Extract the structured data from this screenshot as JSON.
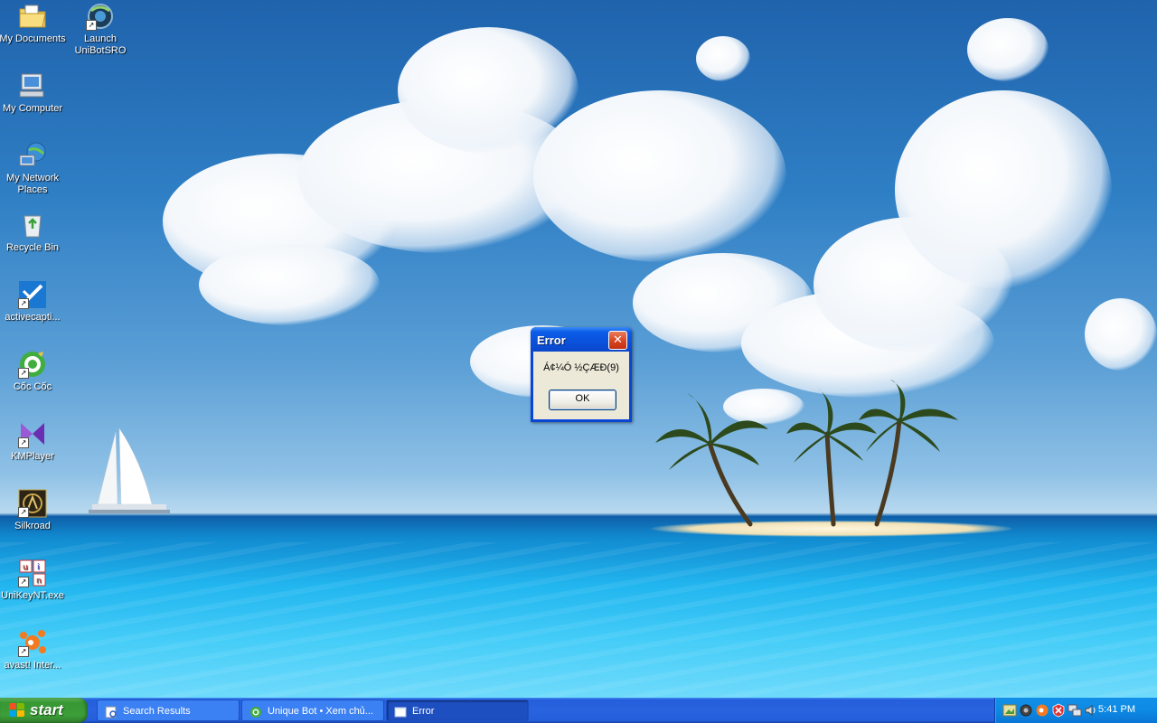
{
  "desktop": {
    "icons": [
      {
        "label": "My Documents",
        "icon": "folder-documents-icon"
      },
      {
        "label": "Launch UniBotSRO",
        "icon": "unibot-icon"
      },
      {
        "label": "My Computer",
        "icon": "computer-icon"
      },
      {
        "label": "My Network Places",
        "icon": "network-icon"
      },
      {
        "label": "Recycle Bin",
        "icon": "recycle-bin-icon"
      },
      {
        "label": "activecapti...",
        "icon": "activecaptain-icon"
      },
      {
        "label": "Cốc Cốc",
        "icon": "coccoc-icon"
      },
      {
        "label": "KMPlayer",
        "icon": "kmplayer-icon"
      },
      {
        "label": "Silkroad",
        "icon": "silkroad-icon"
      },
      {
        "label": "UniKeyNT.exe",
        "icon": "unikey-icon"
      },
      {
        "label": "avast! Inter...",
        "icon": "avast-icon"
      }
    ]
  },
  "dialog": {
    "title": "Error",
    "message": "Á¢¼Ó ½ÇÆÐ(9)",
    "ok_label": "OK",
    "close_glyph": "✕"
  },
  "taskbar": {
    "start_label": "start",
    "tasks": [
      {
        "label": "Search Results",
        "active": false
      },
      {
        "label": "Unique Bot • Xem chủ...",
        "active": false
      },
      {
        "label": "Error",
        "active": true
      }
    ],
    "clock": "5:41 PM"
  },
  "colors": {
    "taskbar_blue": "#245edb",
    "start_green": "#379733",
    "tray_blue": "#0d8ae4",
    "dialog_title_blue": "#0a4fd8",
    "close_red": "#d5401e",
    "dialog_body": "#ece9d8"
  }
}
